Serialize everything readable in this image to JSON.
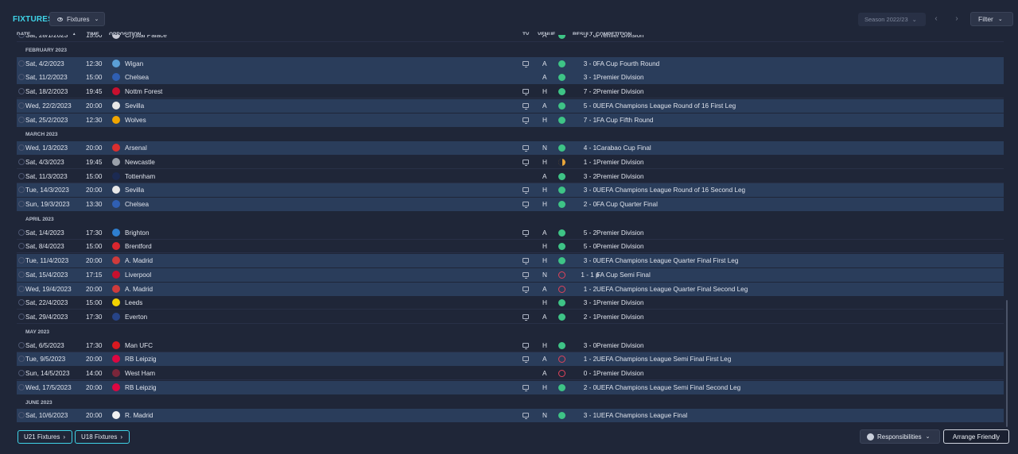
{
  "header": {
    "title": "FIXTURES",
    "view_label": "Fixtures",
    "season_label": "Season 2022/23",
    "filter_label": "Filter"
  },
  "columns": {
    "date": "DATE",
    "time": "TIME",
    "opposition": "OPPOSITION",
    "tv": "TV",
    "venue": "VENUE",
    "result": "RESULT",
    "competition": "COMPETITION"
  },
  "rows": [
    {
      "kind": "fixture",
      "date": "Sat, 28/1/2023",
      "time": "15:00",
      "opp": "Crystal Palace",
      "tv": false,
      "venue": "A",
      "outcome": "win",
      "result": "3 - 0",
      "comp": "Premier Division",
      "hl": false,
      "badge": "#c7c9d4"
    },
    {
      "kind": "month",
      "label": "FEBRUARY 2023"
    },
    {
      "kind": "fixture",
      "date": "Sat, 4/2/2023",
      "time": "12:30",
      "opp": "Wigan",
      "tv": true,
      "venue": "A",
      "outcome": "win",
      "result": "3 - 0",
      "comp": "FA Cup Fourth Round",
      "hl": true,
      "badge": "#5b9fd6"
    },
    {
      "kind": "fixture",
      "date": "Sat, 11/2/2023",
      "time": "15:00",
      "opp": "Chelsea",
      "tv": false,
      "venue": "A",
      "outcome": "win",
      "result": "3 - 1",
      "comp": "Premier Division",
      "hl": true,
      "badge": "#2f5fb3"
    },
    {
      "kind": "fixture",
      "date": "Sat, 18/2/2023",
      "time": "19:45",
      "opp": "Nottm Forest",
      "tv": true,
      "venue": "H",
      "outcome": "win",
      "result": "7 - 2",
      "comp": "Premier Division",
      "hl": false,
      "badge": "#c8102e"
    },
    {
      "kind": "fixture",
      "date": "Wed, 22/2/2023",
      "time": "20:00",
      "opp": "Sevilla",
      "tv": true,
      "venue": "A",
      "outcome": "win",
      "result": "5 - 0",
      "comp": "UEFA Champions League Round of 16  First Leg",
      "hl": true,
      "badge": "#e8e8e8"
    },
    {
      "kind": "fixture",
      "date": "Sat, 25/2/2023",
      "time": "12:30",
      "opp": "Wolves",
      "tv": true,
      "venue": "H",
      "outcome": "win",
      "result": "7 - 1",
      "comp": "FA Cup Fifth Round",
      "hl": true,
      "badge": "#f0a500"
    },
    {
      "kind": "month",
      "label": "MARCH 2023"
    },
    {
      "kind": "fixture",
      "date": "Wed, 1/3/2023",
      "time": "20:00",
      "opp": "Arsenal",
      "tv": true,
      "venue": "N",
      "outcome": "win",
      "result": "4 - 1",
      "comp": "Carabao Cup Final",
      "hl": true,
      "badge": "#db2f2f"
    },
    {
      "kind": "fixture",
      "date": "Sat, 4/3/2023",
      "time": "19:45",
      "opp": "Newcastle",
      "tv": true,
      "venue": "H",
      "outcome": "draw",
      "result": "1 - 1",
      "comp": "Premier Division",
      "hl": false,
      "badge": "#9aa0aa"
    },
    {
      "kind": "fixture",
      "date": "Sat, 11/3/2023",
      "time": "15:00",
      "opp": "Tottenham",
      "tv": false,
      "venue": "A",
      "outcome": "win",
      "result": "3 - 2",
      "comp": "Premier Division",
      "hl": false,
      "badge": "#1b2a52"
    },
    {
      "kind": "fixture",
      "date": "Tue, 14/3/2023",
      "time": "20:00",
      "opp": "Sevilla",
      "tv": true,
      "venue": "H",
      "outcome": "win",
      "result": "3 - 0",
      "comp": "UEFA Champions League Round of 16  Second Leg",
      "hl": true,
      "badge": "#e8e8e8"
    },
    {
      "kind": "fixture",
      "date": "Sun, 19/3/2023",
      "time": "13:30",
      "opp": "Chelsea",
      "tv": true,
      "venue": "H",
      "outcome": "win",
      "result": "2 - 0",
      "comp": "FA Cup Quarter Final",
      "hl": true,
      "badge": "#2f5fb3"
    },
    {
      "kind": "month",
      "label": "APRIL 2023"
    },
    {
      "kind": "fixture",
      "date": "Sat, 1/4/2023",
      "time": "17:30",
      "opp": "Brighton",
      "tv": true,
      "venue": "A",
      "outcome": "win",
      "result": "5 - 2",
      "comp": "Premier Division",
      "hl": false,
      "badge": "#2e7fd0"
    },
    {
      "kind": "fixture",
      "date": "Sat, 8/4/2023",
      "time": "15:00",
      "opp": "Brentford",
      "tv": false,
      "venue": "H",
      "outcome": "win",
      "result": "5 - 0",
      "comp": "Premier Division",
      "hl": false,
      "badge": "#d9262e"
    },
    {
      "kind": "fixture",
      "date": "Tue, 11/4/2023",
      "time": "20:00",
      "opp": "A. Madrid",
      "tv": true,
      "venue": "H",
      "outcome": "win",
      "result": "3 - 0",
      "comp": "UEFA Champions League Quarter Final First Leg",
      "hl": true,
      "badge": "#cf3b3b"
    },
    {
      "kind": "fixture",
      "date": "Sat, 15/4/2023",
      "time": "17:15",
      "opp": "Liverpool",
      "tv": true,
      "venue": "N",
      "outcome": "loss",
      "result": "1 - 1 p",
      "comp": "FA Cup Semi Final",
      "hl": true,
      "badge": "#c8102e"
    },
    {
      "kind": "fixture",
      "date": "Wed, 19/4/2023",
      "time": "20:00",
      "opp": "A. Madrid",
      "tv": true,
      "venue": "A",
      "outcome": "loss",
      "result": "1 - 2",
      "comp": "UEFA Champions League Quarter Final Second Leg",
      "hl": true,
      "badge": "#cf3b3b"
    },
    {
      "kind": "fixture",
      "date": "Sat, 22/4/2023",
      "time": "15:00",
      "opp": "Leeds",
      "tv": false,
      "venue": "H",
      "outcome": "win",
      "result": "3 - 1",
      "comp": "Premier Division",
      "hl": false,
      "badge": "#f2d200"
    },
    {
      "kind": "fixture",
      "date": "Sat, 29/4/2023",
      "time": "17:30",
      "opp": "Everton",
      "tv": true,
      "venue": "A",
      "outcome": "win",
      "result": "2 - 1",
      "comp": "Premier Division",
      "hl": false,
      "badge": "#274488"
    },
    {
      "kind": "month",
      "label": "MAY 2023"
    },
    {
      "kind": "fixture",
      "date": "Sat, 6/5/2023",
      "time": "17:30",
      "opp": "Man UFC",
      "tv": true,
      "venue": "H",
      "outcome": "win",
      "result": "3 - 0",
      "comp": "Premier Division",
      "hl": false,
      "badge": "#d81920"
    },
    {
      "kind": "fixture",
      "date": "Tue, 9/5/2023",
      "time": "20:00",
      "opp": "RB Leipzig",
      "tv": true,
      "venue": "A",
      "outcome": "loss",
      "result": "1 - 2",
      "comp": "UEFA Champions League Semi Final First Leg",
      "hl": true,
      "badge": "#dd0741"
    },
    {
      "kind": "fixture",
      "date": "Sun, 14/5/2023",
      "time": "14:00",
      "opp": "West Ham",
      "tv": false,
      "venue": "A",
      "outcome": "loss",
      "result": "0 - 1",
      "comp": "Premier Division",
      "hl": false,
      "badge": "#7a263a"
    },
    {
      "kind": "fixture",
      "date": "Wed, 17/5/2023",
      "time": "20:00",
      "opp": "RB Leipzig",
      "tv": true,
      "venue": "H",
      "outcome": "win",
      "result": "2 - 0",
      "comp": "UEFA Champions League Semi Final Second Leg",
      "hl": true,
      "badge": "#dd0741"
    },
    {
      "kind": "month",
      "label": "JUNE 2023"
    },
    {
      "kind": "fixture",
      "date": "Sat, 10/6/2023",
      "time": "20:00",
      "opp": "R. Madrid",
      "tv": true,
      "venue": "N",
      "outcome": "win",
      "result": "3 - 1",
      "comp": "UEFA Champions League Final",
      "hl": true,
      "badge": "#f1f1f1"
    }
  ],
  "footer": {
    "u21_label": "U21 Fixtures",
    "u18_label": "U18 Fixtures",
    "responsibilities_label": "Responsibilities",
    "arrange_label": "Arrange Friendly"
  }
}
